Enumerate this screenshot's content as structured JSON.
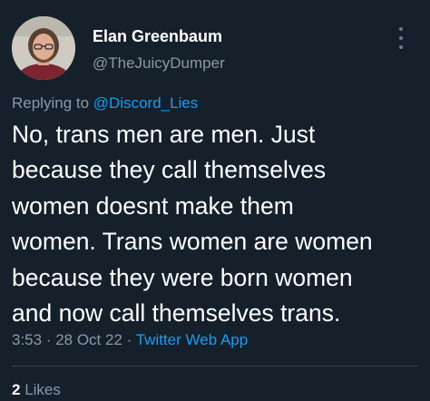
{
  "author": {
    "display_name": "Elan Greenbaum",
    "handle": "@TheJuicyDumper",
    "avatar_icon": "user-avatar-photo"
  },
  "reply": {
    "prefix": "Replying to ",
    "mention": "@Discord_Lies"
  },
  "tweet": {
    "text": "No, trans men are men. Just\nbecause they call themselves\nwomen doesnt make them\nwomen. Trans women are women\nbecause they were born women\nand now call themselves trans."
  },
  "meta": {
    "time": "3:53",
    "separator": " · ",
    "date": "28 Oct 22",
    "app": "Twitter Web App"
  },
  "engagement": {
    "likes_count": "2",
    "likes_label": "Likes"
  },
  "colors": {
    "background": "#15202b",
    "text": "#ffffff",
    "secondary": "#8b98a5",
    "accent": "#1d9bf0"
  }
}
